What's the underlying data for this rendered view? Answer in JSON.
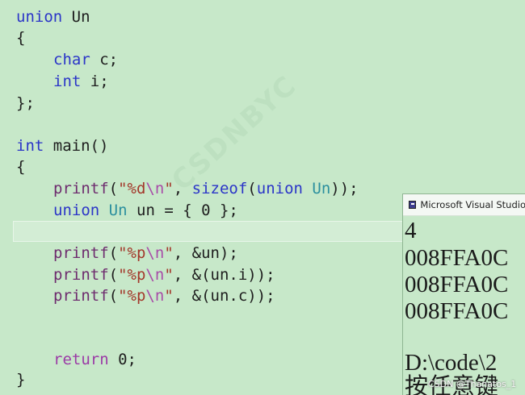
{
  "code": {
    "l1": {
      "k": "union",
      "name": "Un"
    },
    "l2": "{",
    "l3": {
      "t": "char",
      "v": "c;"
    },
    "l4": {
      "t": "int",
      "v": "i;"
    },
    "l5": "};",
    "l7": {
      "t": "int",
      "rest": "main()"
    },
    "l8": "{",
    "l9": {
      "fn": "printf",
      "p1": "(",
      "s1": "\"%d",
      "esc": "\\n",
      "s2": "\"",
      "p2": ", ",
      "kw": "sizeof",
      "p3": "(",
      "k2": "union",
      "p4": " ",
      "ty": "Un",
      "p5": "));"
    },
    "l10": {
      "k": "union",
      "ty": "Un",
      "rest": "un = { 0 };"
    },
    "l12": {
      "fn": "printf",
      "p1": "(",
      "s1": "\"%p",
      "esc": "\\n",
      "s2": "\"",
      "rest": ", &un);"
    },
    "l13": {
      "fn": "printf",
      "p1": "(",
      "s1": "\"%p",
      "esc": "\\n",
      "s2": "\"",
      "rest": ", &(un.i));"
    },
    "l14": {
      "fn": "printf",
      "p1": "(",
      "s1": "\"%p",
      "esc": "\\n",
      "s2": "\"",
      "rest": ", &(un.c));"
    },
    "l17": {
      "k": "return",
      "rest": "0;"
    },
    "l18": "}"
  },
  "watermark": "CSDNBYC",
  "console": {
    "title": "Microsoft Visual Studio",
    "lines": [
      "4",
      "008FFA0C",
      "008FFA0C",
      "008FFA0C",
      "",
      "D:\\code\\2",
      "按任意键"
    ]
  },
  "credit": "CSDN @Thanatos_1"
}
